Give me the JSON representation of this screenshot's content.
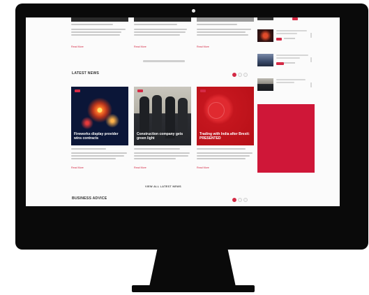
{
  "latest_news": {
    "heading": "LATEST NEWS",
    "view_all": "VIEW ALL LATEST NEWS",
    "articles": [
      {
        "title": "Fireworks display provider wins contracts",
        "read_more": "Read More"
      },
      {
        "title": "Construction company gets green light",
        "read_more": "Read More"
      },
      {
        "title": "Trading with India after Brexit: PRESENTED",
        "read_more": "Read More"
      }
    ]
  },
  "top_articles": [
    {
      "read_more": "Read More"
    },
    {
      "read_more": "Read More"
    },
    {
      "read_more": "Read More"
    }
  ],
  "business_advice": {
    "heading": "BUSINESS ADVICE"
  },
  "colors": {
    "accent": "#d42a45",
    "ad": "#cf1738",
    "frame": "#0a0a0a"
  }
}
